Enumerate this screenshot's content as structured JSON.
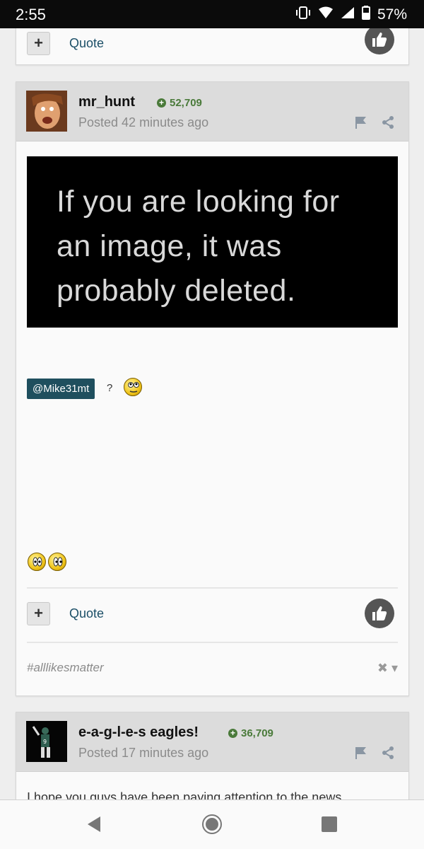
{
  "status_bar": {
    "time": "2:55",
    "battery": "57%"
  },
  "top_fragment": {
    "quote_label": "Quote"
  },
  "post1": {
    "author": "mr_hunt",
    "reputation": "52,709",
    "posted": "Posted 42 minutes ago",
    "image_text": [
      "If you are looking for",
      "an image, it was",
      "probably deleted."
    ],
    "mention": "@Mike31mt",
    "mention_suffix": "?",
    "quote_label": "Quote",
    "hashtag": "#alllikesmatter"
  },
  "post2": {
    "author": "e-a-g-l-e-s eagles!",
    "reputation": "36,709",
    "posted": "Posted 17 minutes ago",
    "snippet": "I hope you guys have been paying attention to the news"
  },
  "colors": {
    "accent": "#1f4f5e",
    "reputation": "#4a7a3a",
    "header_bg": "#dcdcdc"
  }
}
